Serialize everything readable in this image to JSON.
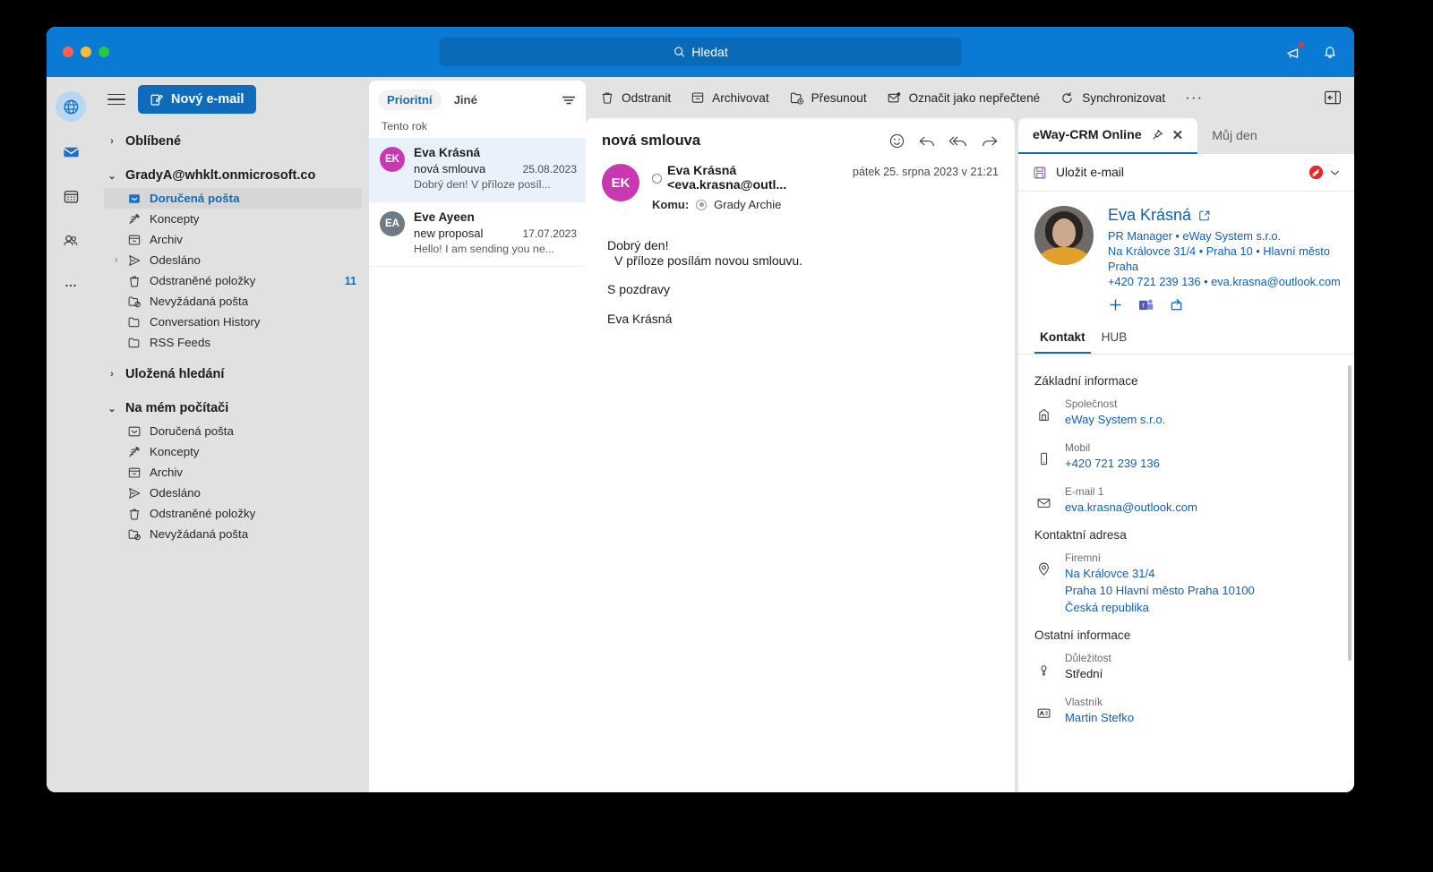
{
  "titlebar": {
    "search_placeholder": "Hledat",
    "icons": [
      "megaphone-icon",
      "bell-icon"
    ]
  },
  "rail": {
    "items": [
      {
        "name": "globe",
        "label": "Globe"
      },
      {
        "name": "mail",
        "label": "Mail"
      },
      {
        "name": "calendar",
        "label": "Calendar"
      },
      {
        "name": "people",
        "label": "People"
      },
      {
        "name": "more",
        "label": "More"
      }
    ]
  },
  "left": {
    "new_mail_label": "Nový e-mail",
    "groups": [
      {
        "label": "Oblíbené",
        "expanded": false,
        "items": []
      },
      {
        "label": "GradyA@whklt.onmicrosoft.co",
        "expanded": true,
        "items": [
          {
            "label": "Doručená pošta",
            "icon": "inbox-icon",
            "selected": true,
            "count": "",
            "chevron": false
          },
          {
            "label": "Koncepty",
            "icon": "drafts-icon",
            "selected": false,
            "count": "",
            "chevron": false
          },
          {
            "label": "Archiv",
            "icon": "archive-icon",
            "selected": false,
            "count": "",
            "chevron": false
          },
          {
            "label": "Odesláno",
            "icon": "sent-icon",
            "selected": false,
            "count": "",
            "chevron": true
          },
          {
            "label": "Odstraněné položky",
            "icon": "trash-icon",
            "selected": false,
            "count": "11",
            "chevron": false
          },
          {
            "label": "Nevyžádaná pošta",
            "icon": "junk-icon",
            "selected": false,
            "count": "",
            "chevron": false
          },
          {
            "label": "Conversation History",
            "icon": "folder-icon",
            "selected": false,
            "count": "",
            "chevron": false
          },
          {
            "label": "RSS Feeds",
            "icon": "folder-icon",
            "selected": false,
            "count": "",
            "chevron": false
          }
        ]
      },
      {
        "label": "Uložená hledání",
        "expanded": false,
        "items": []
      },
      {
        "label": "Na mém počítači",
        "expanded": true,
        "items": [
          {
            "label": "Doručená pošta",
            "icon": "inbox-icon",
            "selected": false,
            "count": "",
            "chevron": false
          },
          {
            "label": "Koncepty",
            "icon": "drafts-icon",
            "selected": false,
            "count": "",
            "chevron": false
          },
          {
            "label": "Archiv",
            "icon": "archive-icon",
            "selected": false,
            "count": "",
            "chevron": false
          },
          {
            "label": "Odesláno",
            "icon": "sent-icon",
            "selected": false,
            "count": "",
            "chevron": false
          },
          {
            "label": "Odstraněné položky",
            "icon": "trash-icon",
            "selected": false,
            "count": "",
            "chevron": false
          },
          {
            "label": "Nevyžádaná pošta",
            "icon": "junk-icon",
            "selected": false,
            "count": "",
            "chevron": false
          }
        ]
      }
    ]
  },
  "toolbar": {
    "delete_label": "Odstranit",
    "archive_label": "Archivovat",
    "move_label": "Přesunout",
    "mark_unread_label": "Označit jako nepřečtené",
    "sync_label": "Synchronizovat",
    "overflow_label": "···"
  },
  "message_list": {
    "tabs": [
      {
        "label": "Prioritní",
        "active": true
      },
      {
        "label": "Jiné",
        "active": false
      }
    ],
    "group_label": "Tento rok",
    "messages": [
      {
        "initials": "EK",
        "avatar_color": "#c838b0",
        "from": "Eva Krásná",
        "subject": "nová smlouva",
        "date": "25.08.2023",
        "preview": "Dobrý den! V příloze posíl...",
        "selected": true
      },
      {
        "initials": "EA",
        "avatar_color": "#6e7b84",
        "from": "Eve Ayeen",
        "subject": "new proposal",
        "date": "17.07.2023",
        "preview": "Hello! I am sending you ne...",
        "selected": false
      }
    ]
  },
  "reader": {
    "subject": "nová smlouva",
    "sender_initials": "EK",
    "sender": "Eva Krásná <eva.krasna@outl...",
    "to_label": "Komu:",
    "to_value": "Grady Archie",
    "date": "pátek 25. srpna 2023 v 21:21",
    "body": [
      "Dobrý den!",
      "  V příloze posílám novou smlouvu.",
      "S pozdravy",
      "Eva Krásná"
    ],
    "body_line1": "Dobrý den!",
    "body_line2": "V příloze posílám novou smlouvu.",
    "body_line3": "S pozdravy",
    "body_line4": "Eva Krásná"
  },
  "crm": {
    "tabs": [
      {
        "label": "eWay-CRM Online",
        "active": true
      },
      {
        "label": "Můj den",
        "active": false
      }
    ],
    "save_email_label": "Uložit e-mail",
    "contact": {
      "name": "Eva Krásná",
      "role_company": "PR Manager • eWay System s.r.o.",
      "address_line": "Na Královce 31/4 • Praha 10 • Hlavní město Praha",
      "phone_email": "+420 721 239 136 • eva.krasna@outlook.com"
    },
    "sub_tabs": [
      {
        "label": "Kontakt",
        "active": true
      },
      {
        "label": "HUB",
        "active": false
      }
    ],
    "sections": [
      {
        "title": "Základní informace",
        "fields": [
          {
            "icon": "company-icon",
            "label": "Společnost",
            "values": [
              "eWay System s.r.o."
            ],
            "link": true
          },
          {
            "icon": "mobile-icon",
            "label": "Mobil",
            "values": [
              "+420 721 239 136"
            ],
            "link": true
          },
          {
            "icon": "email-icon",
            "label": "E-mail 1",
            "values": [
              "eva.krasna@outlook.com"
            ],
            "link": true
          }
        ]
      },
      {
        "title": "Kontaktní adresa",
        "fields": [
          {
            "icon": "location-icon",
            "label": "Firemní",
            "values": [
              "Na Královce 31/4",
              "Praha 10 Hlavní město Praha 10100",
              "Česká republika"
            ],
            "link": true
          }
        ]
      },
      {
        "title": "Ostatní informace",
        "fields": [
          {
            "icon": "importance-icon",
            "label": "Důležitost",
            "values": [
              "Střední"
            ],
            "link": false
          },
          {
            "icon": "owner-icon",
            "label": "Vlastník",
            "values": [
              "Martin Stefko"
            ],
            "link": true
          }
        ]
      }
    ]
  },
  "colors": {
    "accent": "#0f6cbd",
    "titlebar": "#0a7ad4",
    "link": "#1160b0",
    "avatar_pink": "#c838b0",
    "avatar_gray": "#6e7b84",
    "eway_red": "#e8252a"
  }
}
